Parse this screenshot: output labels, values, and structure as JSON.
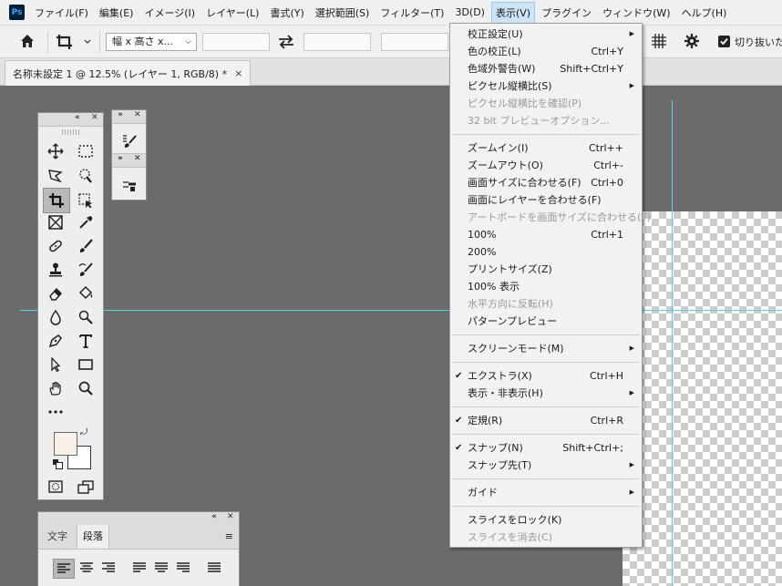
{
  "menubar": {
    "app_logo": "Ps",
    "items": [
      {
        "label": "ファイル(F)"
      },
      {
        "label": "編集(E)"
      },
      {
        "label": "イメージ(I)"
      },
      {
        "label": "レイヤー(L)"
      },
      {
        "label": "書式(Y)"
      },
      {
        "label": "選択範囲(S)"
      },
      {
        "label": "フィルター(T)"
      },
      {
        "label": "3D(D)"
      },
      {
        "label": "表示(V)"
      },
      {
        "label": "プラグイン"
      },
      {
        "label": "ウィンドウ(W)"
      },
      {
        "label": "ヘルプ(H)"
      }
    ]
  },
  "options": {
    "ratio_select": "幅 x 高さ x...",
    "delete_cropped_label": "切り抜いた"
  },
  "document": {
    "tab_title": "名称未設定 1 @ 12.5% (レイヤー 1, RGB/8) *",
    "close": "×"
  },
  "paragraph_panel": {
    "tabs": [
      "文字",
      "段落"
    ]
  },
  "dropdown": {
    "items": [
      {
        "label": "校正設定(U)",
        "shortcut": "",
        "submenu": true
      },
      {
        "label": "色の校正(L)",
        "shortcut": "Ctrl+Y"
      },
      {
        "label": "色域外警告(W)",
        "shortcut": "Shift+Ctrl+Y"
      },
      {
        "label": "ピクセル縦横比(S)",
        "shortcut": "",
        "submenu": true
      },
      {
        "label": "ピクセル縦横比を確認(P)",
        "shortcut": "",
        "disabled": true
      },
      {
        "label": "32 bit プレビューオプション...",
        "shortcut": "",
        "disabled": true
      },
      {
        "separator": true
      },
      {
        "label": "ズームイン(I)",
        "shortcut": "Ctrl++"
      },
      {
        "label": "ズームアウト(O)",
        "shortcut": "Ctrl+-"
      },
      {
        "label": "画面サイズに合わせる(F)",
        "shortcut": "Ctrl+0"
      },
      {
        "label": "画面にレイヤーを合わせる(F)",
        "shortcut": ""
      },
      {
        "label": "アートボードを画面サイズに合わせる(F)",
        "shortcut": "",
        "disabled": true
      },
      {
        "label": "100%",
        "shortcut": "Ctrl+1"
      },
      {
        "label": "200%",
        "shortcut": ""
      },
      {
        "label": "プリントサイズ(Z)",
        "shortcut": ""
      },
      {
        "label": "100% 表示",
        "shortcut": ""
      },
      {
        "label": "水平方向に反転(H)",
        "shortcut": "",
        "disabled": true
      },
      {
        "label": "パターンプレビュー",
        "shortcut": ""
      },
      {
        "separator": true
      },
      {
        "label": "スクリーンモード(M)",
        "shortcut": "",
        "submenu": true
      },
      {
        "separator": true
      },
      {
        "label": "エクストラ(X)",
        "shortcut": "Ctrl+H",
        "checked": true
      },
      {
        "label": "表示・非表示(H)",
        "shortcut": "",
        "submenu": true
      },
      {
        "separator": true
      },
      {
        "label": "定規(R)",
        "shortcut": "Ctrl+R",
        "checked": true
      },
      {
        "separator": true
      },
      {
        "label": "スナップ(N)",
        "shortcut": "Shift+Ctrl+;",
        "checked": true
      },
      {
        "label": "スナップ先(T)",
        "shortcut": "",
        "submenu": true
      },
      {
        "separator": true
      },
      {
        "label": "ガイド",
        "shortcut": "",
        "submenu": true
      },
      {
        "separator": true
      },
      {
        "label": "スライスをロック(K)",
        "shortcut": ""
      },
      {
        "label": "スライスを消去(C)",
        "shortcut": "",
        "disabled": true
      }
    ]
  },
  "colors": {
    "guide": "#4fd5e6",
    "menu_active_bg": "#cce4f7",
    "canvas_bg": "#6a6a6a",
    "foreground_swatch": "#f7f1e8",
    "background_swatch": "#ffffff"
  }
}
